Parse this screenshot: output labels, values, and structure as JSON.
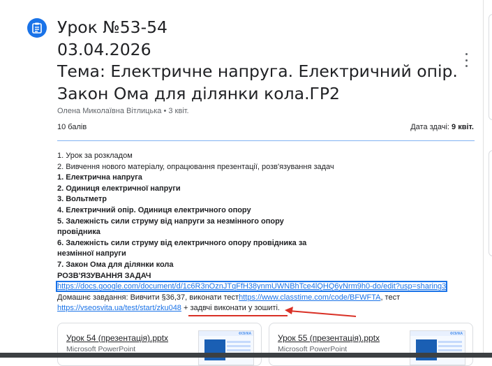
{
  "assignment": {
    "title_lines": [
      "Урок №53-54",
      "03.04.2026",
      "Тема: Електричне напруга. Електричний опір.",
      "Закон Ома для ділянки кола.ГР2"
    ],
    "author": "Олена Миколаївна Вітлицька",
    "posted": "3 квіт.",
    "points": "10 балів",
    "due_label": "Дата здачі:",
    "due_value": "9 квіт."
  },
  "body": {
    "plain_items": [
      "1. Урок за розкладом",
      "2. Вивчення нового матеріалу, опрацювання презентації, розв'язування задач"
    ],
    "bold_items": [
      "1. Електрична напруга",
      "2. Одиниця електричної напруги",
      "3. Вольтметр",
      "4. Електричний опір. Одиниця електричного опору",
      "5. Залежність сили струму від напруги за незмінного опору",
      "провідника",
      "6. Залежність сили струму від електричного опору провідника за",
      "незмінної напруги",
      "7. Закон Ома для ділянки кола",
      "РОЗВ'ЯЗУВАННЯ ЗАДАЧ"
    ],
    "doc_link": "https://docs.google.com/document/d/1c6R3nOznJTqFfH38ynmUWNBhTce4lQHQ6yNrm9h0-do/edit?usp=sharing3",
    "hw_prefix": "Домашнє завдання: Вивчити §36,37, виконати тест",
    "classtime_link": "https://www.classtime.com/code/BFWFTA",
    "hw_mid": ", тест",
    "vseosvita_link": "https://vseosvita.ua/test/start/zku048",
    "hw_suffix": " + задвчі виконати у зошиті."
  },
  "attachments": [
    {
      "name": "Урок 54 (презентація).pptx",
      "type": "Microsoft PowerPoint",
      "thumb_brand": "ФІЗИКА"
    },
    {
      "name": "Урок 55 (презентація).pptx",
      "type": "Microsoft PowerPoint",
      "thumb_brand": "ФІЗИКА"
    }
  ],
  "colors": {
    "accent": "#1a73e8",
    "annotation": "#d93025"
  },
  "icons": {
    "assignment": "assignment-icon",
    "more": "more-vert-icon"
  }
}
